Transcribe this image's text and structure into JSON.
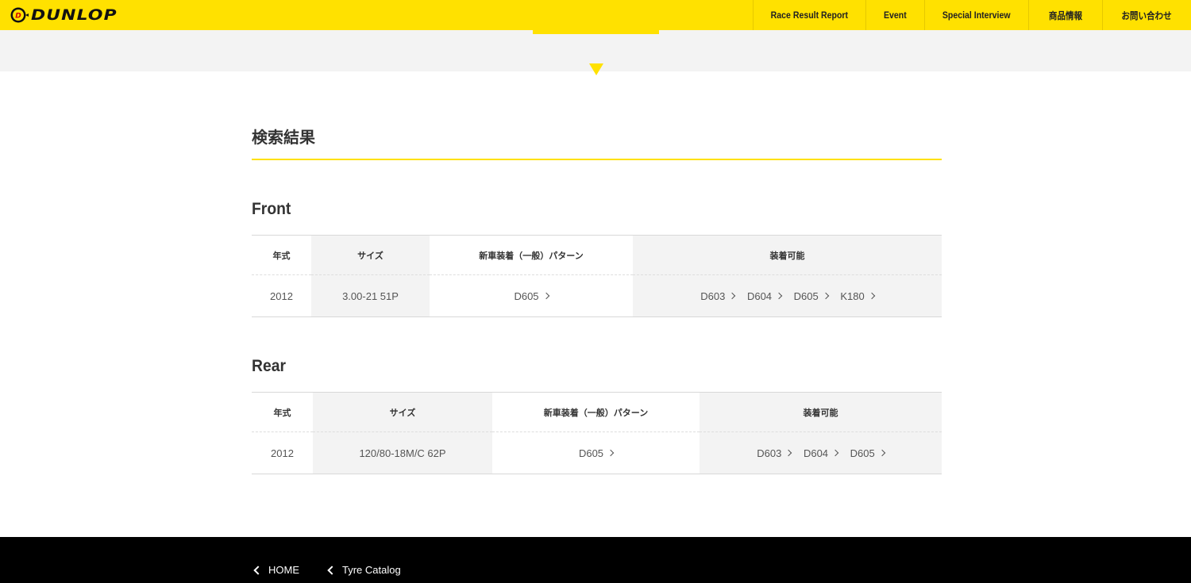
{
  "header": {
    "brand": "DUNLOP",
    "nav": [
      {
        "label": "Race Result Report"
      },
      {
        "label": "Event"
      },
      {
        "label": "Special Interview"
      },
      {
        "label": "商品情報"
      },
      {
        "label": "お問い合わせ"
      }
    ]
  },
  "main": {
    "title": "検索結果",
    "columns": {
      "year": "年式",
      "size": "サイズ",
      "oem_pattern": "新車装着（一般）パターン",
      "compatible": "装着可能"
    },
    "front": {
      "title": "Front",
      "year": "2012",
      "size": "3.00-21 51P",
      "oem_pattern": "D605",
      "compatible": [
        "D603",
        "D604",
        "D605",
        "K180"
      ]
    },
    "rear": {
      "title": "Rear",
      "year": "2012",
      "size": "120/80-18M/C 62P",
      "oem_pattern": "D605",
      "compatible": [
        "D603",
        "D604",
        "D605"
      ]
    }
  },
  "footer": {
    "breadcrumbs": [
      {
        "label": "HOME"
      },
      {
        "label": "Tyre Catalog"
      }
    ]
  },
  "colors": {
    "brand_yellow": "#ffe100",
    "band_gray": "#f3f3f3",
    "footer_black": "#000000"
  }
}
